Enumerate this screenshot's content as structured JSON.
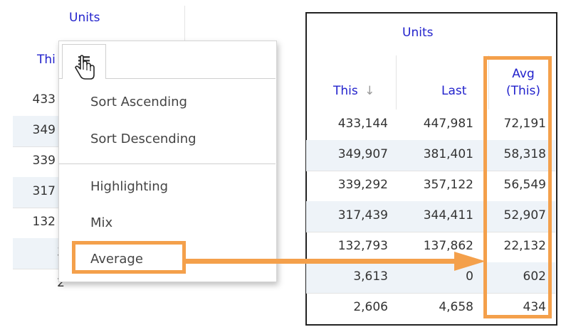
{
  "left_table": {
    "group_header": "Units",
    "col_header_partial": "Thi",
    "rows": [
      "433",
      "349",
      "339",
      "317",
      "132",
      "3",
      "2"
    ]
  },
  "menu": {
    "items": [
      "Sort Ascending",
      "Sort Descending",
      "Highlighting",
      "Mix",
      "Average"
    ]
  },
  "right_table": {
    "group_header": "Units",
    "columns": {
      "this": "This",
      "this_sort": "↓",
      "last": "Last",
      "avg_line1": "Avg",
      "avg_line2": "(This)"
    },
    "rows": [
      [
        "433,144",
        "447,981",
        "72,191"
      ],
      [
        "349,907",
        "381,401",
        "58,318"
      ],
      [
        "339,292",
        "357,122",
        "56,549"
      ],
      [
        "317,439",
        "344,411",
        "52,907"
      ],
      [
        "132,793",
        "137,862",
        "22,132"
      ],
      [
        "3,613",
        "0",
        "602"
      ],
      [
        "2,606",
        "4,658",
        "434"
      ]
    ]
  },
  "colors": {
    "header_text": "#2222cc",
    "highlight": "#f4a04b",
    "row_shade": "#eef3f8"
  },
  "icons": [
    "menu-lines-icon",
    "hand-pointer-icon"
  ]
}
